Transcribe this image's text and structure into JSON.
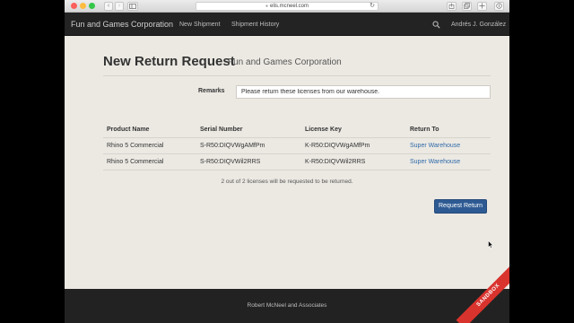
{
  "browser": {
    "url": "elis.mcneel.com",
    "back_glyph": "‹",
    "forward_glyph": "›"
  },
  "navbar": {
    "brand": "Fun and Games Corporation",
    "links": [
      "New Shipment",
      "Shipment History"
    ],
    "user": "Andrés J. González"
  },
  "page": {
    "title": "New Return Request",
    "subtitle": "Fun and Games Corporation"
  },
  "remarks": {
    "label": "Remarks",
    "value": "Please return these licenses from our warehouse."
  },
  "table": {
    "headers": [
      "Product Name",
      "Serial Number",
      "License Key",
      "Return To"
    ],
    "rows": [
      [
        "Rhino 5 Commercial",
        "S-R50:DIQVWgAMfPm",
        "K-R50:DIQVWgAMfPm",
        "Super Warehouse"
      ],
      [
        "Rhino 5 Commercial",
        "S-R50:DIQVWil2RRS",
        "K-R50:DIQVWil2RRS",
        "Super Warehouse"
      ]
    ]
  },
  "summary": "2 out of 2 licenses will be requested to be returned.",
  "actions": {
    "request_return": "Request Return"
  },
  "footer": {
    "text": "Robert McNeel and Associates"
  },
  "ribbon": {
    "text": "SANDBOX",
    "color": "#d9332d"
  },
  "colors": {
    "navbar": "#232323",
    "link": "#2f6aa8",
    "primary_button": "#2d5a93",
    "background": "#ece9e3"
  },
  "icons": [
    "lock-icon",
    "reload-icon",
    "search-icon",
    "share-icon",
    "tabs-icon",
    "new-tab-icon",
    "downloads-icon"
  ]
}
